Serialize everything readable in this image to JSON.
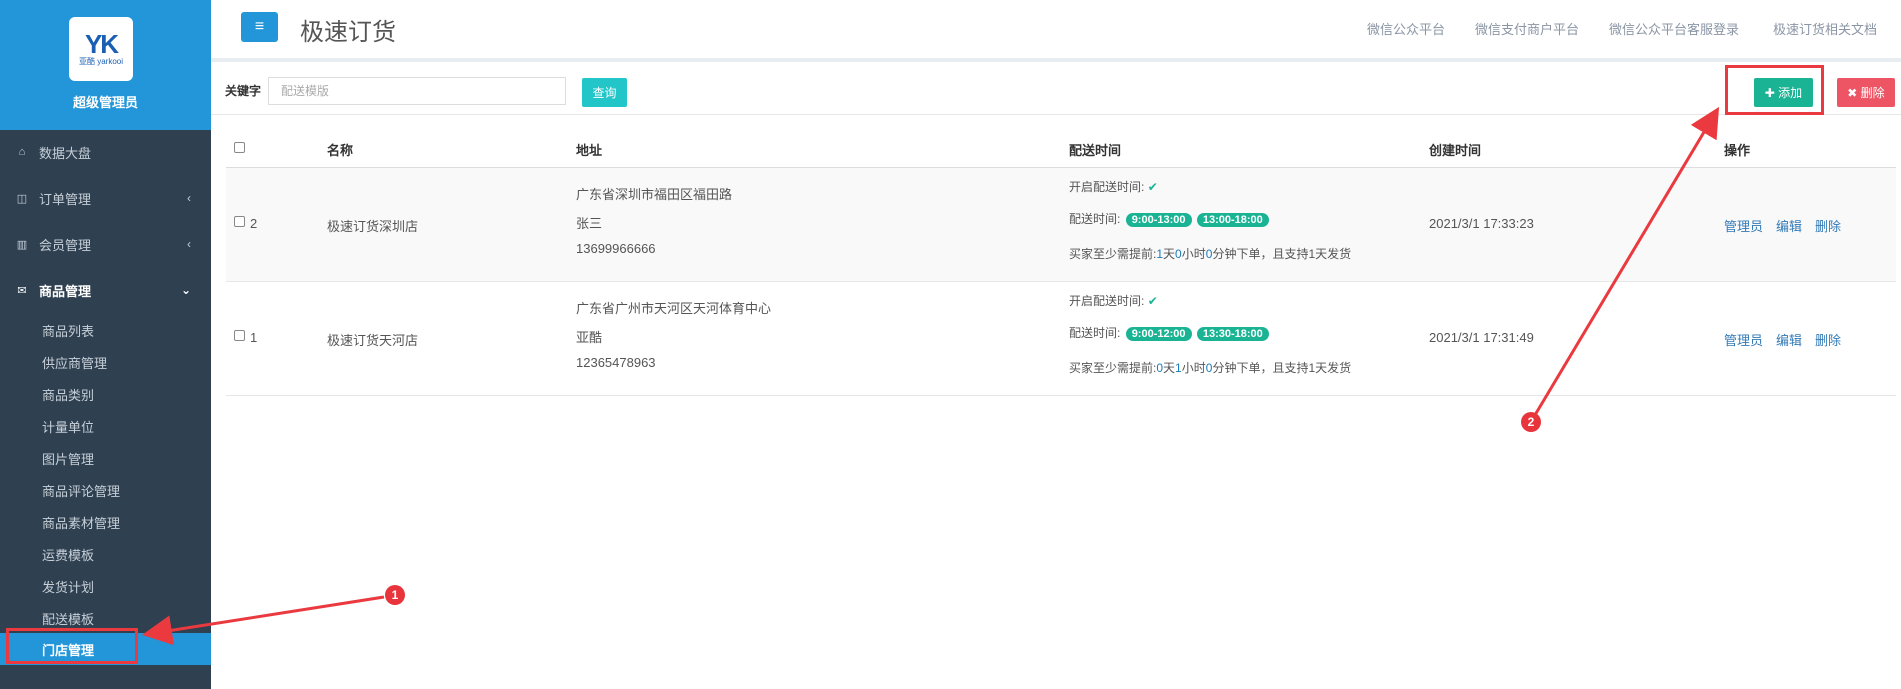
{
  "sidebar": {
    "brand_title": "超级管理员",
    "logo_mark": "YK",
    "logo_sub": "亚酷 yarkooi",
    "items": [
      {
        "label": "数据大盘",
        "icon": "home-icon"
      },
      {
        "label": "订单管理",
        "icon": "columns-icon"
      },
      {
        "label": "会员管理",
        "icon": "bar-chart-icon"
      },
      {
        "label": "商品管理",
        "icon": "envelope-icon"
      }
    ],
    "subitems": [
      "商品列表",
      "供应商管理",
      "商品类别",
      "计量单位",
      "图片管理",
      "商品评论管理",
      "商品素材管理",
      "运费模板",
      "发货计划",
      "配送模板",
      "门店管理"
    ]
  },
  "header": {
    "title": "极速订货",
    "links": [
      "微信公众平台",
      "微信支付商户平台",
      "微信公众平台客服登录",
      "极速订货相关文档"
    ]
  },
  "toolbar": {
    "keyword_label": "关键字",
    "keyword_placeholder": "配送模版",
    "query_label": "查询",
    "add_label": "✚ 添加",
    "delete_label": "✖ 删除"
  },
  "table": {
    "headers": [
      "名称",
      "地址",
      "配送时间",
      "创建时间",
      "操作"
    ],
    "rows": [
      {
        "id": "2",
        "name": "极速订货深圳店",
        "address": "广东省深圳市福田区福田路",
        "contact": "张三",
        "phone": "13699966666",
        "open_label": "开启配送时间:",
        "time_label": "配送时间:",
        "slots": [
          "9:00-13:00",
          "13:00-18:00"
        ],
        "advance_prefix": "买家至少需提前:",
        "advance_days": "1",
        "advance_hours": "0",
        "advance_minutes": "0",
        "advance_suffix": "分钟下单，且支持1天发货",
        "created": "2021/3/1 17:33:23"
      },
      {
        "id": "1",
        "name": "极速订货天河店",
        "address": "广东省广州市天河区天河体育中心",
        "contact": "亚酷",
        "phone": "12365478963",
        "open_label": "开启配送时间:",
        "time_label": "配送时间:",
        "slots": [
          "9:00-12:00",
          "13:30-18:00"
        ],
        "advance_prefix": "买家至少需提前:",
        "advance_days": "0",
        "advance_hours": "1",
        "advance_minutes": "0",
        "advance_suffix": "分钟下单，且支持1天发货",
        "created": "2021/3/1 17:31:49"
      }
    ],
    "actions": [
      "管理员",
      "编辑",
      "删除"
    ],
    "unit_day": "天",
    "unit_hour": "小时"
  },
  "annotations": {
    "badge1": "1",
    "badge2": "2",
    "color": "#ea3a3f"
  }
}
